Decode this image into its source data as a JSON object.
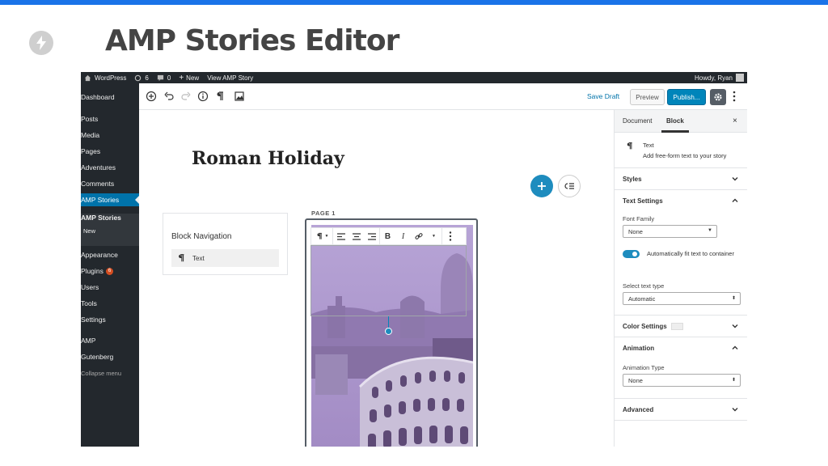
{
  "slide": {
    "title": "AMP Stories Editor"
  },
  "admin_bar": {
    "site": "WordPress",
    "updates": "6",
    "comments": "0",
    "new": "New",
    "view": "View AMP Story",
    "greeting": "Howdy, Ryan"
  },
  "sidebar": {
    "items": [
      {
        "label": "Dashboard"
      },
      {
        "label": "Posts"
      },
      {
        "label": "Media"
      },
      {
        "label": "Pages"
      },
      {
        "label": "Adventures"
      },
      {
        "label": "Comments"
      },
      {
        "label": "AMP Stories"
      },
      {
        "label": "AMP Stories"
      },
      {
        "label": "New"
      },
      {
        "label": "Appearance"
      },
      {
        "label": "Plugins"
      },
      {
        "label": "Users"
      },
      {
        "label": "Tools"
      },
      {
        "label": "Settings"
      },
      {
        "label": "AMP"
      },
      {
        "label": "Gutenberg"
      },
      {
        "label": "Collapse menu"
      }
    ],
    "plugins_badge": "6"
  },
  "toolbar": {
    "save_draft": "Save Draft",
    "preview": "Preview",
    "publish": "Publish..."
  },
  "editor": {
    "story_title": "Roman Holiday",
    "page_label": "PAGE 1"
  },
  "block_navigation": {
    "title": "Block Navigation",
    "item": "Text"
  },
  "settings": {
    "tab_document": "Document",
    "tab_block": "Block",
    "close": "×",
    "block_name": "Text",
    "block_desc": "Add free-form text to your story",
    "styles": "Styles",
    "text_settings": "Text Settings",
    "font_family_label": "Font Family",
    "font_family_value": "None",
    "auto_fit_label": "Automatically fit text to container",
    "select_text_type_label": "Select text type",
    "text_type_value": "Automatic",
    "color_settings": "Color Settings",
    "animation": "Animation",
    "animation_type_label": "Animation Type",
    "animation_type_value": "None",
    "advanced": "Advanced"
  },
  "colors": {
    "accent": "#0073aa",
    "admin_dark": "#23282d",
    "image_tint": "#a48fc6"
  }
}
